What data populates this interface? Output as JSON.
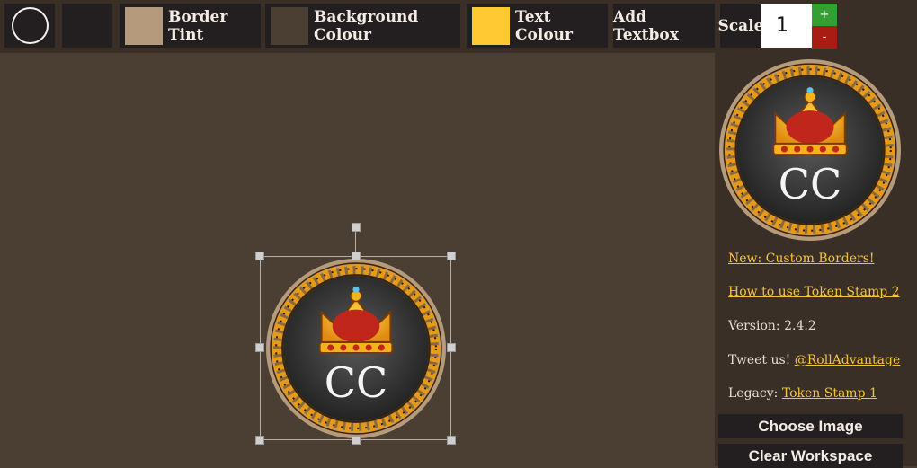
{
  "toolbar": {
    "border_tint_label": "Border Tint",
    "background_colour_label": "Background Colour",
    "text_colour_label": "Text Colour",
    "add_textbox_label": "Add Textbox",
    "scale_label": "Scale",
    "scale_value": "1",
    "plus_label": "+",
    "minus_label": "-",
    "border_tint_color": "#b59a7c",
    "background_colour_color": "#4b3e32",
    "text_colour_color": "#ffc933"
  },
  "token": {
    "text": "CC"
  },
  "sidebar": {
    "preview_text": "CC",
    "new_custom_borders": "New: Custom Borders!",
    "how_to_use": "How to use Token Stamp 2",
    "version": "Version: 2.4.2",
    "tweet_prefix": "Tweet us!",
    "tweet_handle": "@RollAdvantage",
    "legacy_prefix": "Legacy:",
    "legacy_link": "Token Stamp 1",
    "choose_image": "Choose Image",
    "clear_workspace": "Clear Workspace"
  },
  "colors": {
    "workspace_bg": "#4b3e32",
    "toolbar_bg": "#3a2f26",
    "button_bg": "#231f20",
    "link": "#f3c43a",
    "plus_green": "#33a032",
    "minus_red": "#a81c13"
  }
}
